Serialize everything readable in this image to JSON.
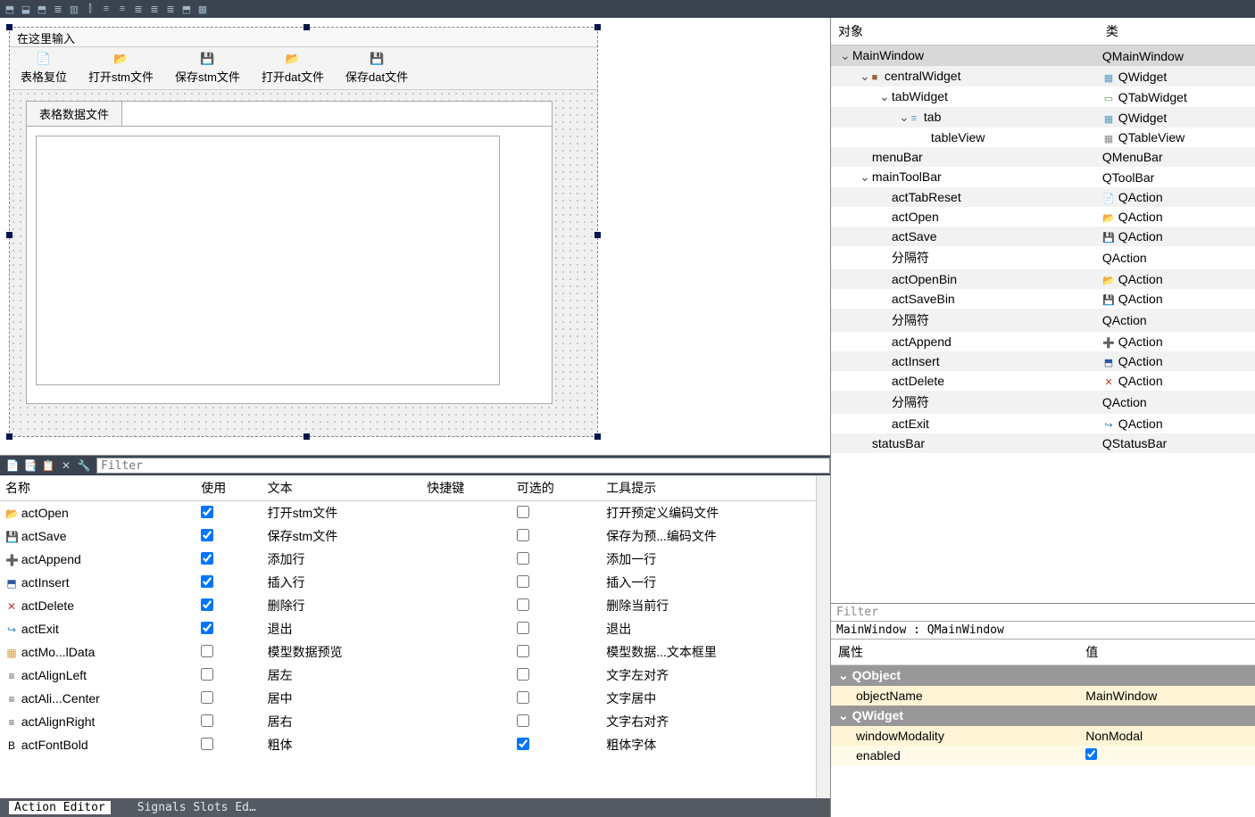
{
  "toolbar_icons": [
    "⬒",
    "⬓",
    "⬒",
    "≣",
    "▥",
    "⫿",
    "≡",
    "≡",
    "≣",
    "≣",
    "≣",
    "⬒",
    "▦"
  ],
  "designer": {
    "menubar_placeholder": "在这里输入",
    "toolbar_buttons": [
      {
        "label": "表格复位",
        "icon": "📄",
        "color": "#4a90d9"
      },
      {
        "label": "打开stm文件",
        "icon": "📂",
        "color": "#d9a43a"
      },
      {
        "label": "保存stm文件",
        "icon": "💾",
        "color": "#2a5aa0"
      },
      {
        "label": "打开dat文件",
        "icon": "📂",
        "color": "#5a9a3a"
      },
      {
        "label": "保存dat文件",
        "icon": "💾",
        "color": "#7a7a7a"
      }
    ],
    "tab_label": "表格数据文件"
  },
  "action_editor": {
    "filter_placeholder": "Filter",
    "headers": [
      "名称",
      "使用",
      "文本",
      "快捷键",
      "可选的",
      "工具提示"
    ],
    "rows": [
      {
        "icon": "📂",
        "iconColor": "#d9a43a",
        "name": "actOpen",
        "use": true,
        "text": "打开stm文件",
        "shortcut": "",
        "checkable": false,
        "tooltip": "打开预定义编码文件"
      },
      {
        "icon": "💾",
        "iconColor": "#2a5aa0",
        "name": "actSave",
        "use": true,
        "text": "保存stm文件",
        "shortcut": "",
        "checkable": false,
        "tooltip": "保存为预...编码文件"
      },
      {
        "icon": "➕",
        "iconColor": "#2a5aa0",
        "name": "actAppend",
        "use": true,
        "text": "添加行",
        "shortcut": "",
        "checkable": false,
        "tooltip": "添加一行"
      },
      {
        "icon": "⬒",
        "iconColor": "#2a5aa0",
        "name": "actInsert",
        "use": true,
        "text": "插入行",
        "shortcut": "",
        "checkable": false,
        "tooltip": "插入一行"
      },
      {
        "icon": "✕",
        "iconColor": "#c0392b",
        "name": "actDelete",
        "use": true,
        "text": "删除行",
        "shortcut": "",
        "checkable": false,
        "tooltip": "删除当前行"
      },
      {
        "icon": "↪",
        "iconColor": "#3a8ac0",
        "name": "actExit",
        "use": true,
        "text": "退出",
        "shortcut": "",
        "checkable": false,
        "tooltip": "退出"
      },
      {
        "icon": "▦",
        "iconColor": "#d9a43a",
        "name": "actMo...lData",
        "use": false,
        "text": "模型数据预览",
        "shortcut": "",
        "checkable": false,
        "tooltip": "模型数据...文本框里"
      },
      {
        "icon": "≡",
        "iconColor": "#555",
        "name": "actAlignLeft",
        "use": false,
        "text": "居左",
        "shortcut": "",
        "checkable": false,
        "tooltip": "文字左对齐"
      },
      {
        "icon": "≡",
        "iconColor": "#555",
        "name": "actAli...Center",
        "use": false,
        "text": "居中",
        "shortcut": "",
        "checkable": false,
        "tooltip": "文字居中"
      },
      {
        "icon": "≡",
        "iconColor": "#555",
        "name": "actAlignRight",
        "use": false,
        "text": "居右",
        "shortcut": "",
        "checkable": false,
        "tooltip": "文字右对齐"
      },
      {
        "icon": "B",
        "iconColor": "#000",
        "name": "actFontBold",
        "use": false,
        "text": "粗体",
        "shortcut": "",
        "checkable": true,
        "tooltip": "粗体字体"
      }
    ],
    "tabs": [
      "Action Editor",
      "Signals Slots Ed…"
    ]
  },
  "object_tree": {
    "headers": [
      "对象",
      "类"
    ],
    "rows": [
      {
        "depth": 0,
        "expand": "v",
        "icon": "",
        "iconColor": "",
        "name": "MainWindow",
        "cls": "QMainWindow",
        "sel": true
      },
      {
        "depth": 1,
        "expand": "v",
        "icon": "■",
        "iconColor": "#a06030",
        "name": "centralWidget",
        "cls": "QWidget",
        "clsIcon": "▦",
        "clsColor": "#5a9ac0"
      },
      {
        "depth": 2,
        "expand": "v",
        "icon": "",
        "iconColor": "",
        "name": "tabWidget",
        "cls": "QTabWidget",
        "clsIcon": "▭",
        "clsColor": "#5a9a3a"
      },
      {
        "depth": 3,
        "expand": "v",
        "icon": "≡",
        "iconColor": "#5a9ac0",
        "name": "tab",
        "cls": "QWidget",
        "clsIcon": "▦",
        "clsColor": "#5a9ac0"
      },
      {
        "depth": 4,
        "expand": "",
        "icon": "",
        "iconColor": "",
        "name": "tableView",
        "cls": "QTableView",
        "clsIcon": "▦",
        "clsColor": "#888"
      },
      {
        "depth": 1,
        "expand": "",
        "icon": "",
        "iconColor": "",
        "name": "menuBar",
        "cls": "QMenuBar"
      },
      {
        "depth": 1,
        "expand": "v",
        "icon": "",
        "iconColor": "",
        "name": "mainToolBar",
        "cls": "QToolBar"
      },
      {
        "depth": 2,
        "expand": "",
        "icon": "",
        "iconColor": "",
        "name": "actTabReset",
        "cls": "QAction",
        "clsIcon": "📄",
        "clsColor": "#4a90d9"
      },
      {
        "depth": 2,
        "expand": "",
        "icon": "",
        "iconColor": "",
        "name": "actOpen",
        "cls": "QAction",
        "clsIcon": "📂",
        "clsColor": "#d9a43a"
      },
      {
        "depth": 2,
        "expand": "",
        "icon": "",
        "iconColor": "",
        "name": "actSave",
        "cls": "QAction",
        "clsIcon": "💾",
        "clsColor": "#2a5aa0"
      },
      {
        "depth": 2,
        "expand": "",
        "icon": "",
        "iconColor": "",
        "name": "分隔符",
        "cls": "QAction"
      },
      {
        "depth": 2,
        "expand": "",
        "icon": "",
        "iconColor": "",
        "name": "actOpenBin",
        "cls": "QAction",
        "clsIcon": "📂",
        "clsColor": "#5a9a3a"
      },
      {
        "depth": 2,
        "expand": "",
        "icon": "",
        "iconColor": "",
        "name": "actSaveBin",
        "cls": "QAction",
        "clsIcon": "💾",
        "clsColor": "#7a7a7a"
      },
      {
        "depth": 2,
        "expand": "",
        "icon": "",
        "iconColor": "",
        "name": "分隔符",
        "cls": "QAction"
      },
      {
        "depth": 2,
        "expand": "",
        "icon": "",
        "iconColor": "",
        "name": "actAppend",
        "cls": "QAction",
        "clsIcon": "➕",
        "clsColor": "#2a5aa0"
      },
      {
        "depth": 2,
        "expand": "",
        "icon": "",
        "iconColor": "",
        "name": "actInsert",
        "cls": "QAction",
        "clsIcon": "⬒",
        "clsColor": "#2a5aa0"
      },
      {
        "depth": 2,
        "expand": "",
        "icon": "",
        "iconColor": "",
        "name": "actDelete",
        "cls": "QAction",
        "clsIcon": "✕",
        "clsColor": "#c0392b"
      },
      {
        "depth": 2,
        "expand": "",
        "icon": "",
        "iconColor": "",
        "name": "分隔符",
        "cls": "QAction"
      },
      {
        "depth": 2,
        "expand": "",
        "icon": "",
        "iconColor": "",
        "name": "actExit",
        "cls": "QAction",
        "clsIcon": "↪",
        "clsColor": "#3a8ac0"
      },
      {
        "depth": 1,
        "expand": "",
        "icon": "",
        "iconColor": "",
        "name": "statusBar",
        "cls": "QStatusBar"
      }
    ]
  },
  "properties": {
    "filter_placeholder": "Filter",
    "info": "MainWindow : QMainWindow",
    "headers": [
      "属性",
      "值"
    ],
    "groups": [
      {
        "name": "QObject",
        "rows": [
          {
            "k": "objectName",
            "v": "MainWindow",
            "type": "text"
          }
        ]
      },
      {
        "name": "QWidget",
        "rows": [
          {
            "k": "windowModality",
            "v": "NonModal",
            "type": "text"
          },
          {
            "k": "enabled",
            "v": true,
            "type": "check"
          }
        ]
      }
    ]
  }
}
